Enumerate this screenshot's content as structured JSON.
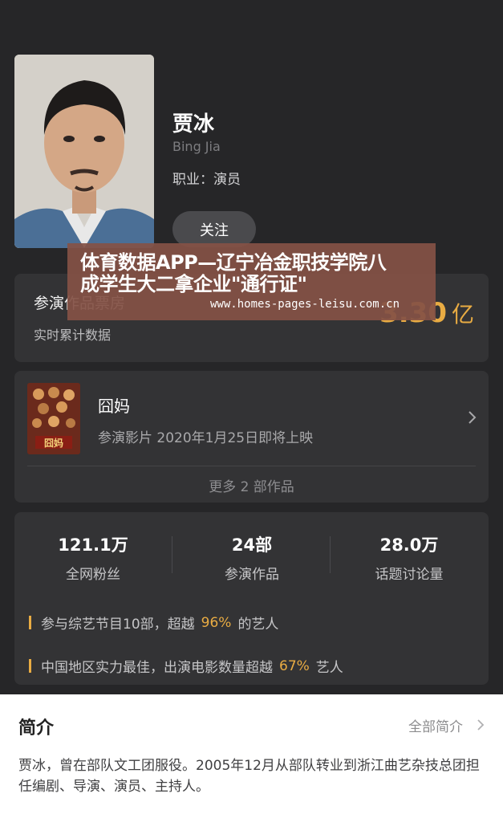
{
  "profile": {
    "name_cn": "贾冰",
    "name_en": "Bing Jia",
    "job": "职业：演员",
    "follow_label": "关注"
  },
  "box_office": {
    "title": "参演作品票房",
    "subtitle": "实时累计数据",
    "value": "3.30",
    "unit": "亿"
  },
  "banner": {
    "line1": "体育数据APP—辽宁冶金职技学院八",
    "line2": "成学生大二拿企业\"通行证\"",
    "url": "www.homes-pages-leisu.com.cn"
  },
  "works": {
    "title": "囧妈",
    "subtitle": "参演影片 2020年1月25日即将上映",
    "poster_text": "囧妈",
    "more_label": "更多 2 部作品"
  },
  "stats": {
    "items": [
      {
        "value": "121.1万",
        "label": "全网粉丝"
      },
      {
        "value": "24部",
        "label": "参演作品"
      },
      {
        "value": "28.0万",
        "label": "话题讨论量"
      }
    ],
    "line1": {
      "prefix": "参与综艺节目10部，超越",
      "highlight": "96%",
      "suffix": "的艺人"
    },
    "line2": {
      "prefix": "中国地区实力最佳，出演电影数量超越",
      "highlight": "67%",
      "suffix": "艺人"
    }
  },
  "intro": {
    "title": "简介",
    "all_label": "全部简介",
    "text": "贾冰，曾在部队文工团服役。2005年12月从部队转业到浙江曲艺杂技总团担任编剧、导演、演员、主持人。"
  },
  "colors": {
    "background": "#262628",
    "card": "#333335",
    "accent": "#e9ac43"
  }
}
